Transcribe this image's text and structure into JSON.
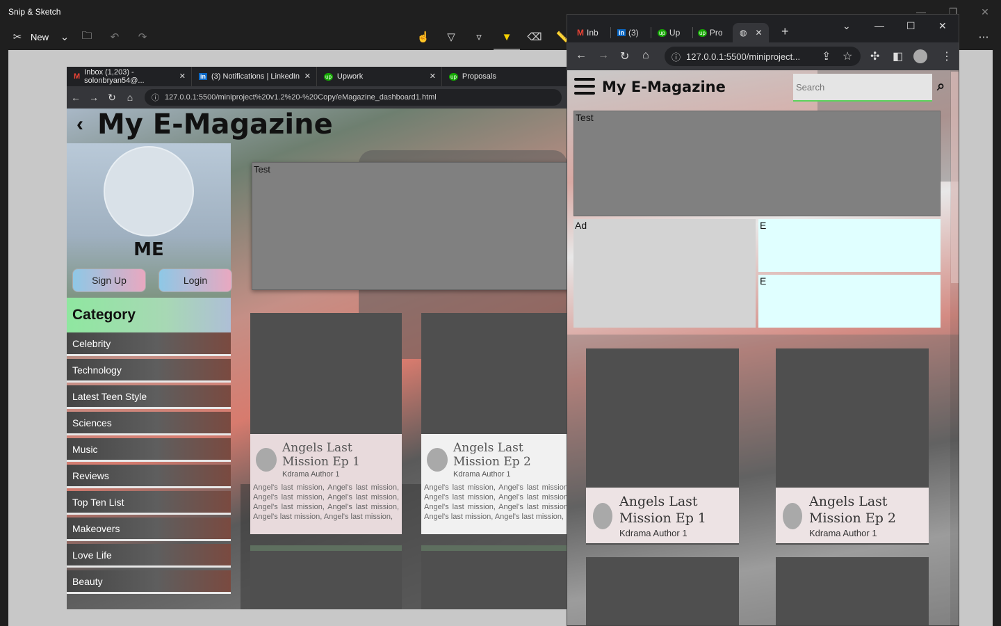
{
  "snip": {
    "window_title": "Snip & Sketch",
    "new_label": "New"
  },
  "left_browser": {
    "tabs": [
      {
        "label": "Inbox (1,203) - solonbryan54@..."
      },
      {
        "label": "(3) Notifications | LinkedIn"
      },
      {
        "label": "Upwork"
      },
      {
        "label": "Proposals"
      }
    ],
    "url": "127.0.0.1:5500/miniproject%20v1.2%20-%20Copy/eMagazine_dashboard1.html",
    "page": {
      "back_symbol": "‹",
      "title": "My E-Magazine",
      "profile_name": "ME",
      "signup_label": "Sign Up",
      "login_label": "Login",
      "category_heading": "Category",
      "categories": [
        "Celebrity",
        "Technology",
        "Latest Teen Style",
        "Sciences",
        "Music",
        "Reviews",
        "Top Ten List",
        "Makeovers",
        "Love Life",
        "Beauty"
      ],
      "test_label": "Test",
      "cards": [
        {
          "title": "Angels Last Mission Ep 1",
          "author": "Kdrama Author 1",
          "desc": "Angel's last mission, Angel's last mission, Angel's last mission, Angel's last mission, Angel's last mission, Angel's last mission, Angel's last mission, Angel's last mission,"
        },
        {
          "title": "Angels Last Mission Ep 2",
          "author": "Kdrama Author 1",
          "desc": "Angel's last mission, Angel's last mission, Angel's last mission, Angel's last mission, Angel's last mission, Angel's last mission, Angel's last mission, Angel's last mission,"
        }
      ]
    }
  },
  "right_browser": {
    "tabs": [
      {
        "label": "Inb"
      },
      {
        "label": "(3)"
      },
      {
        "label": "Up"
      },
      {
        "label": "Pro"
      }
    ],
    "url": "127.0.0.1:5500/miniproject...",
    "page": {
      "title": "My E-Magazine",
      "search_placeholder": "Search",
      "test_label": "Test",
      "ad_label": "Ad",
      "e_label_1": "E",
      "e_label_2": "E",
      "cards": [
        {
          "title": "Angels Last Mission Ep 1",
          "author": "Kdrama Author 1"
        },
        {
          "title": "Angels Last Mission Ep 2",
          "author": "Kdrama Author 1"
        }
      ]
    }
  },
  "colors": {
    "accent_green": "#5bd45b",
    "ad_box": "#d3d3d3",
    "e_box": "#e0ffff",
    "test_box": "#808080"
  }
}
